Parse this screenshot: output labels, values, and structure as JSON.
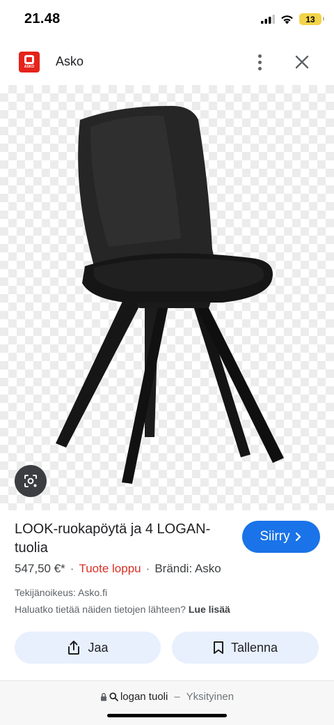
{
  "status_bar": {
    "time": "21.48",
    "battery_level": "13",
    "icons": [
      "cellular-signal-icon",
      "wifi-icon",
      "battery-icon"
    ]
  },
  "app_bar": {
    "logo_text": "ASKO",
    "title": "Asko",
    "icons": [
      "more-vert-icon",
      "close-icon"
    ]
  },
  "image": {
    "icons": [
      "lens-search-icon"
    ]
  },
  "product": {
    "title": "LOOK-ruokapöytä ja 4 LOGAN-tuolia",
    "go_label": "Siirry",
    "price": "547,50 €*",
    "availability": "Tuote loppu",
    "availability_color": "#d93025",
    "brand": "Brändi: Asko",
    "copyright": "Tekijänoikeus: Asko.fi",
    "source_question": "Haluatko tietää näiden tietojen lähteen?",
    "learn_more": "Lue lisää"
  },
  "actions": {
    "share_label": "Jaa",
    "save_label": "Tallenna",
    "accent": "#1a73e8",
    "button_bg": "#e8f0fe"
  },
  "bottom_bar": {
    "query": "logan tuoli",
    "separator": "–",
    "mode": "Yksityinen"
  }
}
